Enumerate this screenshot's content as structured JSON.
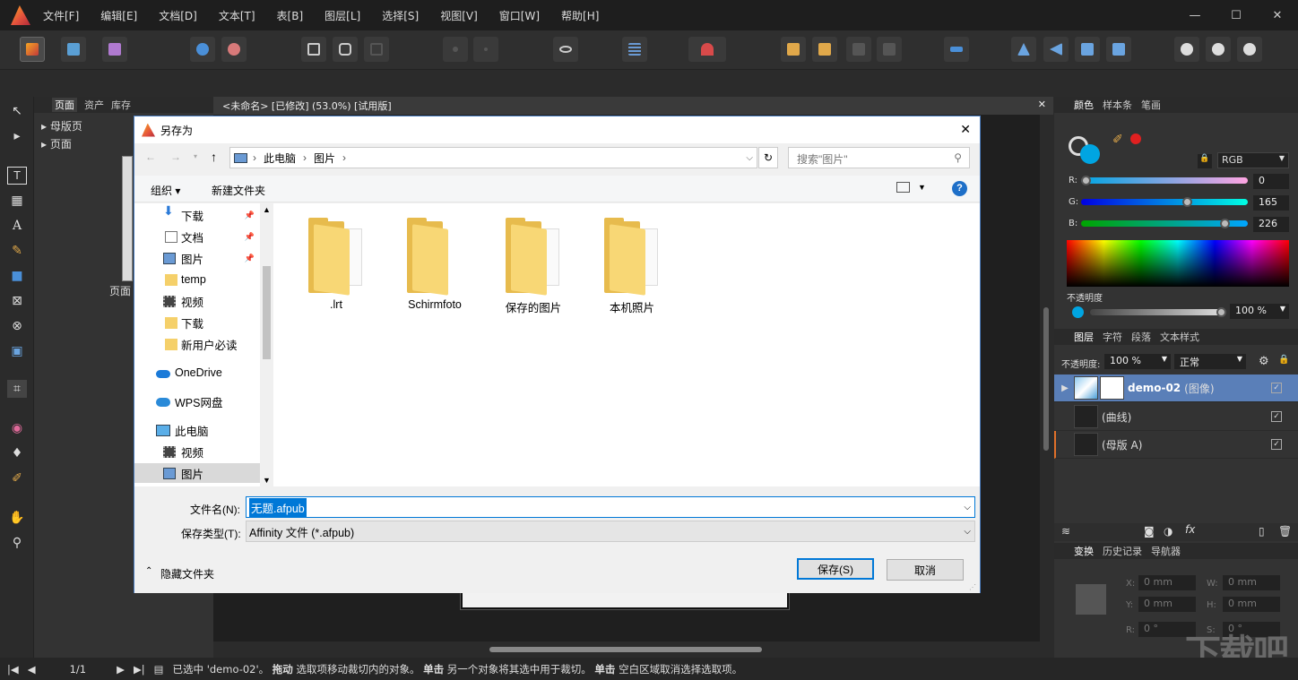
{
  "menubar": {
    "items": [
      "文件[F]",
      "编辑[E]",
      "文档[D]",
      "文本[T]",
      "表[B]",
      "图层[L]",
      "选择[S]",
      "视图[V]",
      "窗口[W]",
      "帮助[H]"
    ]
  },
  "window_controls": {
    "minimize": "—",
    "maximize": "☐",
    "close": "✕"
  },
  "pages_panel": {
    "tabs": [
      "页面",
      "资产",
      "库存"
    ],
    "items": [
      "母版页",
      "页面"
    ],
    "page_label": "页面"
  },
  "document": {
    "tab_title": "<未命名> [已修改] (53.0%) [试用版]"
  },
  "right_panel": {
    "color_tabs": [
      "颜色",
      "样本条",
      "笔画"
    ],
    "color_model": "RGB",
    "r_label": "R:",
    "g_label": "G:",
    "b_label": "B:",
    "r": "0",
    "g": "165",
    "b": "226",
    "r_frac": 0,
    "g_frac": 0.647,
    "b_frac": 0.886,
    "opacity_label": "不透明度",
    "opacity": "100 %",
    "layer_tabs": [
      "图层",
      "字符",
      "段落",
      "文本样式"
    ],
    "layer_opacity_label": "不透明度:",
    "layer_opacity": "100 %",
    "blend_mode": "正常",
    "layers": [
      {
        "name": "demo-02",
        "type": "(图像)",
        "checked": "✓"
      },
      {
        "name": "(曲线)",
        "type": "",
        "checked": "✓"
      },
      {
        "name": "(母版 A)",
        "type": "",
        "checked": "✓"
      }
    ],
    "transform_tabs": [
      "变换",
      "历史记录",
      "导航器"
    ],
    "transform": {
      "x_label": "X:",
      "y_label": "Y:",
      "w_label": "W:",
      "h_label": "H:",
      "r_label": "R:",
      "s_label": "S:",
      "x": "0 mm",
      "y": "0 mm",
      "w": "0 mm",
      "h": "0 mm",
      "r": "0 °",
      "s": "0 °"
    }
  },
  "dialog": {
    "title": "另存为",
    "close": "✕",
    "breadcrumb": [
      "此电脑",
      "图片"
    ],
    "search_placeholder": "搜索\"图片\"",
    "organize": "组织 ▾",
    "new_folder": "新建文件夹",
    "help": "?",
    "nav_items": [
      {
        "label": "下载",
        "pinned": true
      },
      {
        "label": "文档",
        "pinned": true
      },
      {
        "label": "图片",
        "pinned": true
      },
      {
        "label": "temp",
        "pinned": false
      },
      {
        "label": "视频",
        "pinned": false
      },
      {
        "label": "下载",
        "pinned": false
      },
      {
        "label": "新用户必读",
        "pinned": false
      },
      {
        "label": "OneDrive",
        "pinned": false
      },
      {
        "label": "WPS网盘",
        "pinned": false
      },
      {
        "label": "此电脑",
        "pinned": false
      },
      {
        "label": "视频",
        "pinned": false
      },
      {
        "label": "图片",
        "pinned": false
      }
    ],
    "folders": [
      ".lrt",
      "Schirmfoto",
      "保存的图片",
      "本机照片"
    ],
    "filename_label": "文件名(N):",
    "filename": "无题.afpub",
    "filetype_label": "保存类型(T):",
    "filetype": "Affinity 文件 (*.afpub)",
    "hide_folders": "隐藏文件夹",
    "save": "保存(S)",
    "cancel": "取消"
  },
  "statusbar": {
    "page": "1/1",
    "msg_1": "已选中 'demo-02'。",
    "b1": "拖动",
    "msg_2": "选取项移动裁切内的对象。",
    "b2": "单击",
    "msg_3": "另一个对象将其选中用于裁切。",
    "b3": "单击",
    "msg_4": "空白区域取消选择选取项。"
  },
  "watermark": "下载吧"
}
